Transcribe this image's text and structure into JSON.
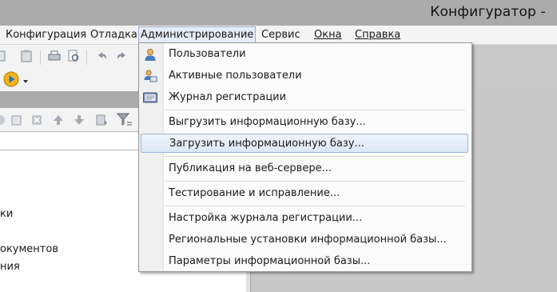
{
  "window": {
    "title": "Конфигуратор -"
  },
  "menubar": {
    "items": [
      {
        "label": "Конфигурация"
      },
      {
        "label": "Отладка"
      },
      {
        "label": "Администрирование"
      },
      {
        "label": "Сервис"
      },
      {
        "label": "Окна"
      },
      {
        "label": "Справка"
      }
    ]
  },
  "admin_menu": {
    "items": [
      {
        "label": "Пользователи",
        "icon": "user-icon"
      },
      {
        "label": "Активные пользователи",
        "icon": "active-users-icon"
      },
      {
        "label": "Журнал регистрации",
        "icon": "log-icon"
      },
      {
        "label": "Выгрузить информационную базу..."
      },
      {
        "label": "Загрузить информационную базу..."
      },
      {
        "label": "Публикация на веб-сервере..."
      },
      {
        "label": "Тестирование и исправление..."
      },
      {
        "label": "Настройка журнала регистрации..."
      },
      {
        "label": "Региональные установки информационной базы..."
      },
      {
        "label": "Параметры информационной базы..."
      }
    ],
    "highlighted_index": 4
  },
  "tree": {
    "partial_items": [
      "ки",
      "окументов",
      "ния"
    ]
  },
  "colors": {
    "titlebar": "#ababab",
    "menu_highlight": "#dce8f6",
    "menu_highlight_border": "#9ab5d8"
  }
}
